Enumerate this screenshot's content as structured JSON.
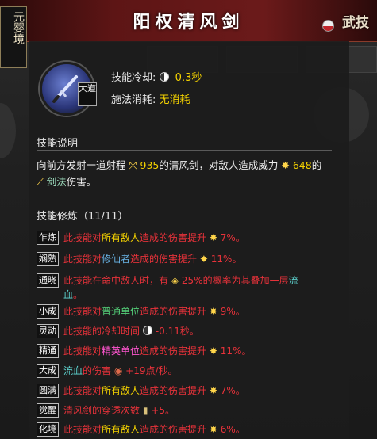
{
  "header": {
    "title": "阳权清风剑",
    "stamp": "武技"
  },
  "realm": "元婴境",
  "skill": {
    "badge": "大道",
    "cooldown_label": "技能冷却:",
    "cooldown_value": "0.3秒",
    "cost_label": "施法消耗:",
    "cost_value": "无消耗"
  },
  "description": {
    "title": "技能说明",
    "part1": "向前方发射一道射程",
    "range": "935",
    "part2": "的清风剑，对敌人造成威力",
    "power": "648",
    "part3": "的",
    "dmg_type": "剑法",
    "part4": "伤害。"
  },
  "cultivation": {
    "title": "技能修炼（11/11）",
    "rows": [
      {
        "badge": "乍炼",
        "a": "此技能对",
        "b": "所有敌人",
        "c": "造成的伤害提升",
        "v": "7%。"
      },
      {
        "badge": "娴熟",
        "a": "此技能对",
        "b": "修仙者",
        "c": "造成的伤害提升",
        "v": "11%。"
      },
      {
        "badge": "通晓",
        "a": "此技能在命中敌人时，有",
        "v": "25%的概率为其叠加一层",
        "b": "流",
        "b2": "血",
        "c": "。"
      },
      {
        "badge": "小成",
        "a": "此技能对",
        "b": "普通单位",
        "c": "造成的伤害提升",
        "v": "9%。"
      },
      {
        "badge": "灵动",
        "a": "此技能的冷却时间",
        "v": "-0.11秒。"
      },
      {
        "badge": "精通",
        "a": "此技能对",
        "b": "精英单位",
        "c": "造成的伤害提升",
        "v": "11%。"
      },
      {
        "badge": "大成",
        "b": "流血",
        "a": "的伤害",
        "v": "+19点/秒。"
      },
      {
        "badge": "圆满",
        "a": "此技能对",
        "b": "所有敌人",
        "c": "造成的伤害提升",
        "v": "7%。"
      },
      {
        "badge": "觉醒",
        "a": "清风剑的穿透次数",
        "v": "+5。"
      },
      {
        "badge": "化境",
        "a": "此技能对",
        "b": "所有敌人",
        "c": "造成的伤害提升",
        "v": "6%。"
      }
    ]
  }
}
